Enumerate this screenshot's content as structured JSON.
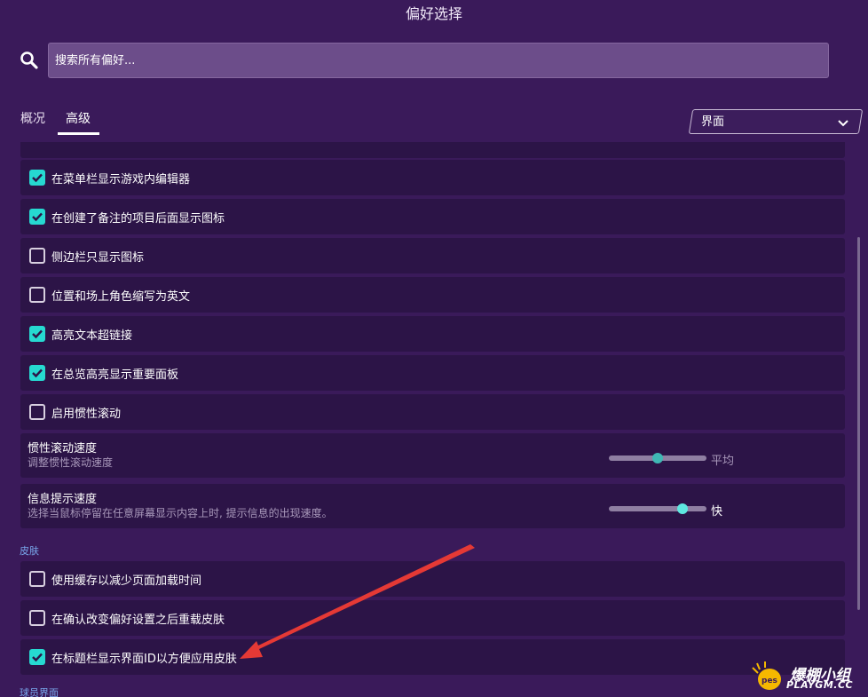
{
  "window": {
    "title": "偏好选择"
  },
  "search": {
    "placeholder": "搜索所有偏好..."
  },
  "tabs": [
    {
      "label": "概况",
      "active": false
    },
    {
      "label": "高级",
      "active": true
    }
  ],
  "category_dropdown": {
    "value": "界面"
  },
  "settings": [
    {
      "label": "在菜单栏显示游戏内编辑器",
      "checked": true
    },
    {
      "label": "在创建了备注的项目后面显示图标",
      "checked": true
    },
    {
      "label": "侧边栏只显示图标",
      "checked": false
    },
    {
      "label": "位置和场上角色缩写为英文",
      "checked": false
    },
    {
      "label": "高亮文本超链接",
      "checked": true
    },
    {
      "label": "在总览高亮显示重要面板",
      "checked": true
    },
    {
      "label": "启用惯性滚动",
      "checked": false
    }
  ],
  "sliders": [
    {
      "title": "惯性滚动速度",
      "description": "调整惯性滚动速度",
      "value_label": "平均",
      "level": 0.5,
      "knob_color": "#3fb8b4",
      "value_color": "#a898ba"
    },
    {
      "title": "信息提示速度",
      "description": "选择当鼠标停留在任意屏幕显示内容上时, 提示信息的出现速度。",
      "value_label": "快",
      "level": 0.75,
      "knob_color": "#5ee8e0",
      "value_color": "#ffffff"
    }
  ],
  "skin_section": {
    "title": "皮肤",
    "settings": [
      {
        "label": "使用缓存以减少页面加载时间",
        "checked": false
      },
      {
        "label": "在确认改变偏好设置之后重载皮肤",
        "checked": false
      },
      {
        "label": "在标题栏显示界面ID以方便应用皮肤",
        "checked": true
      }
    ]
  },
  "next_section": {
    "title": "球员界面"
  },
  "watermark": {
    "brand_cn": "爆棚小组",
    "brand_url": "PLAYGM.CC",
    "logo_text": "pes"
  },
  "colors": {
    "background": "#3a1a5a",
    "row": "#2c1447",
    "checkbox_checked": "#26d9d1",
    "section_title": "#79a8ec",
    "annotation_arrow": "#e53935"
  },
  "icons": [
    "search-icon",
    "chevron-down-icon",
    "checkmark-icon",
    "annotation-arrow"
  ]
}
